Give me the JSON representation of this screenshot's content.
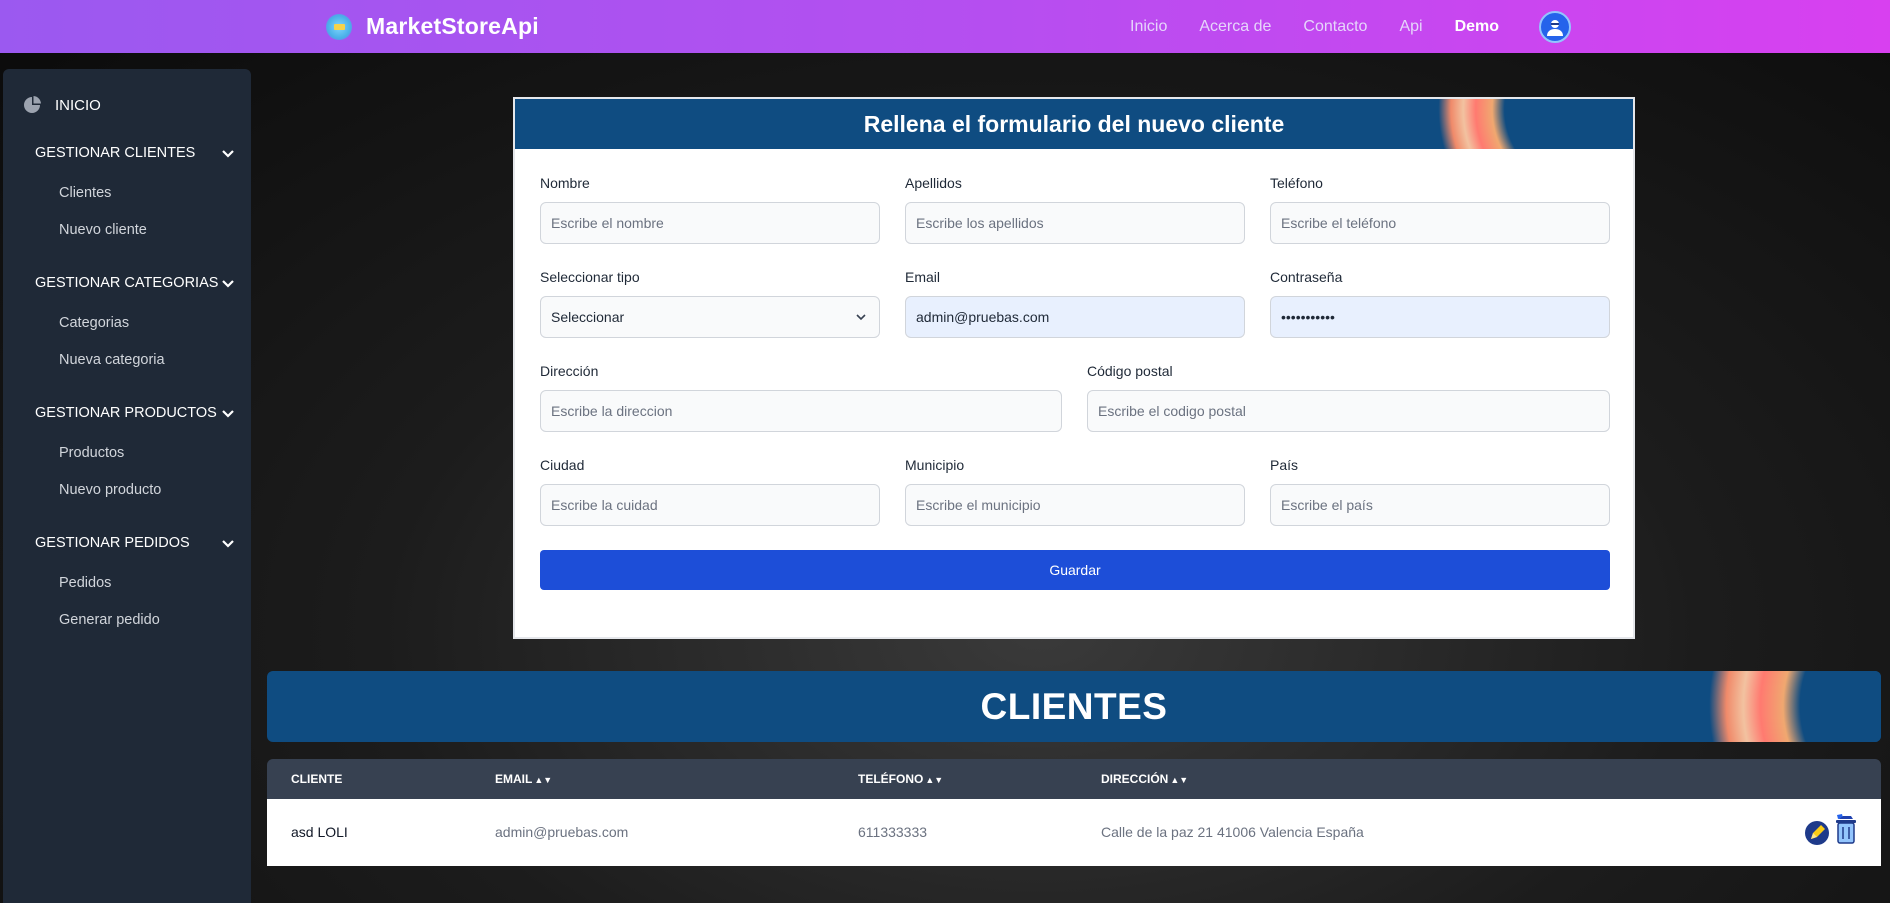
{
  "navbar": {
    "brand": "MarketStoreApi",
    "links": [
      "Inicio",
      "Acerca de",
      "Contacto",
      "Api",
      "Demo"
    ],
    "active_link": "Demo",
    "brand_icon": "store-logo-icon",
    "avatar_icon": "user-avatar-icon"
  },
  "sidebar": {
    "home": "INICIO",
    "sections": [
      {
        "title": "GESTIONAR CLIENTES",
        "items": [
          "Clientes",
          "Nuevo cliente"
        ]
      },
      {
        "title": "GESTIONAR CATEGORIAS",
        "items": [
          "Categorias",
          "Nueva categoria"
        ]
      },
      {
        "title": "GESTIONAR PRODUCTOS",
        "items": [
          "Productos",
          "Nuevo producto"
        ]
      },
      {
        "title": "GESTIONAR PEDIDOS",
        "items": [
          "Pedidos",
          "Generar pedido"
        ]
      }
    ]
  },
  "form": {
    "title": "Rellena el formulario del nuevo cliente",
    "fields": {
      "nombre": {
        "label": "Nombre",
        "placeholder": "Escribe el nombre"
      },
      "apellidos": {
        "label": "Apellidos",
        "placeholder": "Escribe los apellidos"
      },
      "telefono": {
        "label": "Teléfono",
        "placeholder": "Escribe el teléfono"
      },
      "tipo": {
        "label": "Seleccionar tipo",
        "value": "Seleccionar"
      },
      "email": {
        "label": "Email",
        "value": "admin@pruebas.com"
      },
      "password": {
        "label": "Contraseña",
        "value": "•••••••••••"
      },
      "direccion": {
        "label": "Dirección",
        "placeholder": "Escribe la direccion"
      },
      "codigo_postal": {
        "label": "Código postal",
        "placeholder": "Escribe el codigo postal"
      },
      "ciudad": {
        "label": "Ciudad",
        "placeholder": "Escribe la cuidad"
      },
      "municipio": {
        "label": "Municipio",
        "placeholder": "Escribe el municipio"
      },
      "pais": {
        "label": "País",
        "placeholder": "Escribe el país"
      }
    },
    "save_label": "Guardar"
  },
  "clients": {
    "title": "CLIENTES",
    "columns": [
      "CLIENTE",
      "EMAIL",
      "TELÉFONO",
      "DIRECCIÓN"
    ],
    "rows": [
      {
        "cliente": "asd LOLI",
        "email": "admin@pruebas.com",
        "telefono": "611333333",
        "direccion": "Calle de la paz 21 41006 Valencia España"
      }
    ]
  },
  "colors": {
    "navbar_start": "#9b59f0",
    "navbar_end": "#d840f0",
    "header_blue": "#0f4c81",
    "sidebar": "#1f2937",
    "primary_button": "#1d4ed8",
    "table_head": "#374151"
  }
}
